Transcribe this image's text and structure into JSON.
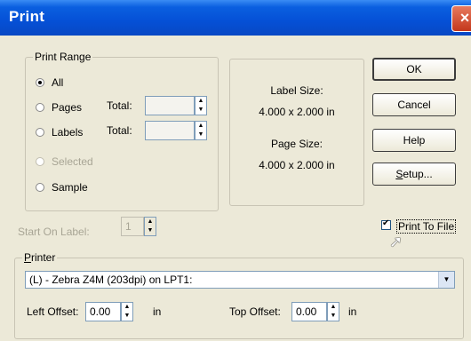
{
  "window": {
    "title": "Print",
    "close_icon": "close-icon"
  },
  "print_range": {
    "legend": "Print Range",
    "options": [
      {
        "label": "All",
        "selected": true,
        "enabled": true
      },
      {
        "label": "Pages",
        "selected": false,
        "enabled": true
      },
      {
        "label": "Labels",
        "selected": false,
        "enabled": true
      },
      {
        "label": "Selected",
        "selected": false,
        "enabled": false
      },
      {
        "label": "Sample",
        "selected": false,
        "enabled": true
      }
    ],
    "total_label": "Total:",
    "pages_total": "",
    "labels_total": ""
  },
  "info": {
    "label_size_label": "Label Size:",
    "label_size_value": "4.000 x 2.000 in",
    "page_size_label": "Page Size:",
    "page_size_value": "4.000 x 2.000 in"
  },
  "buttons": {
    "ok": "OK",
    "cancel": "Cancel",
    "help": "Help",
    "setup": "Setup..."
  },
  "start_on_label": {
    "label": "Start On Label:",
    "value": "1"
  },
  "print_to_file": {
    "label": "Print To File",
    "checked": true
  },
  "printer": {
    "legend": "Printer",
    "selected": "(L) - Zebra Z4M (203dpi) on LPT1:",
    "left_offset_label": "Left Offset:",
    "left_offset_value": "0.00",
    "top_offset_label": "Top Offset:",
    "top_offset_value": "0.00",
    "unit": "in"
  }
}
